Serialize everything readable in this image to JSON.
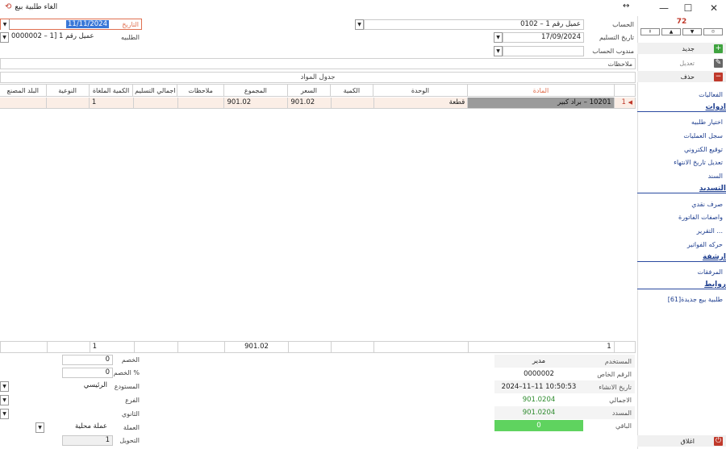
{
  "window": {
    "title": "الغاء طلبية بيع",
    "arrows": "↔"
  },
  "form": {
    "date_label": "التاريخ",
    "date_value": "11/11/2024",
    "order_label": "الطلبيه",
    "order_value": "0000002 – عميل رقم 1 [1",
    "account_label": "الحساب",
    "account_value": "0102 – عميل رقم 1",
    "delivery_label": "تاريخ التسليم",
    "delivery_value": "17/09/2024",
    "rep_label": "مندوب الحساب",
    "rep_value": "",
    "notes_label": "ملاحظات"
  },
  "grid": {
    "title": "جدول المواد",
    "headers": {
      "item": "المادة",
      "unit": "الوحدة",
      "qty": "الكمية",
      "price": "السعر",
      "total": "المجموع",
      "notes": "ملاحظات",
      "delivered": "اجمالي التسليم",
      "cancelled": "الكمية الملغاة",
      "type": "النوعية",
      "origin": "البلد المصنع"
    },
    "row": {
      "num": "1",
      "item": "10201 – براد كبير",
      "unit": "قطعة",
      "qty": "",
      "price": "901.02",
      "total": "901.02",
      "notes": "",
      "delivered": "",
      "cancelled": "1",
      "type": "",
      "origin": ""
    },
    "footer": {
      "count": "1",
      "total": "901.02",
      "cancelled": "1"
    }
  },
  "totals_left": {
    "discount_label": "الخصم",
    "discount_value": "0",
    "discount_pct_label": "الخصم %",
    "discount_pct_value": "0",
    "warehouse_label": "المستودع",
    "warehouse_value": "الرئيسي",
    "branch_label": "الفرع",
    "branch_value": "",
    "secondary_label": "الثانوي",
    "secondary_value": "",
    "currency_label": "العملة",
    "currency_value": "عملة محلية",
    "rate_label": "التحويل",
    "rate_value": "1"
  },
  "info": {
    "user_label": "المستخدم",
    "user_value": "مدير",
    "serial_label": "الرقم الخاص",
    "serial_value": "0000002",
    "created_label": "تاريخ الانشاء",
    "created_value": "2024–11–11 10:50:53",
    "total_label": "الاجمالي",
    "total_value": "901.0204",
    "paid_label": "المسدد",
    "paid_value": "901.0204",
    "remaining_label": "الباقي",
    "remaining_value": "0"
  },
  "right_panel": {
    "counter": "72",
    "nav_buttons": [
      "⯒",
      "▲",
      "▼",
      "⯐"
    ],
    "new_label": "جديد",
    "edit_label": "تعديل",
    "delete_label": "حذف",
    "activities_label": "الفعاليات",
    "tools_header": "ادوات",
    "tools": [
      "اختيار طلبيه",
      "سجل العمليات",
      "توقيع الكتروني",
      "تعديل تاريخ الانتهاء",
      "السند"
    ],
    "payment_header": "التسديد",
    "payment": [
      "صرف نقدي",
      "واصفات الفاتورة",
      "التقرير ...",
      "حركه الفواتير"
    ],
    "archive_header": "ارشفة",
    "archive": [
      "المرفقات"
    ],
    "links_header": "روابط",
    "links": [
      "طلبية بيع جديدة[61]"
    ],
    "close_label": "اغلاق"
  },
  "colors": {
    "accent_red": "#c0392b",
    "link_blue": "#1f3f8f",
    "selected_row": "#9b9b9b",
    "remaining_green": "#5fd35f",
    "new_green": "#3fa33f",
    "delete_red": "#c0392b"
  }
}
